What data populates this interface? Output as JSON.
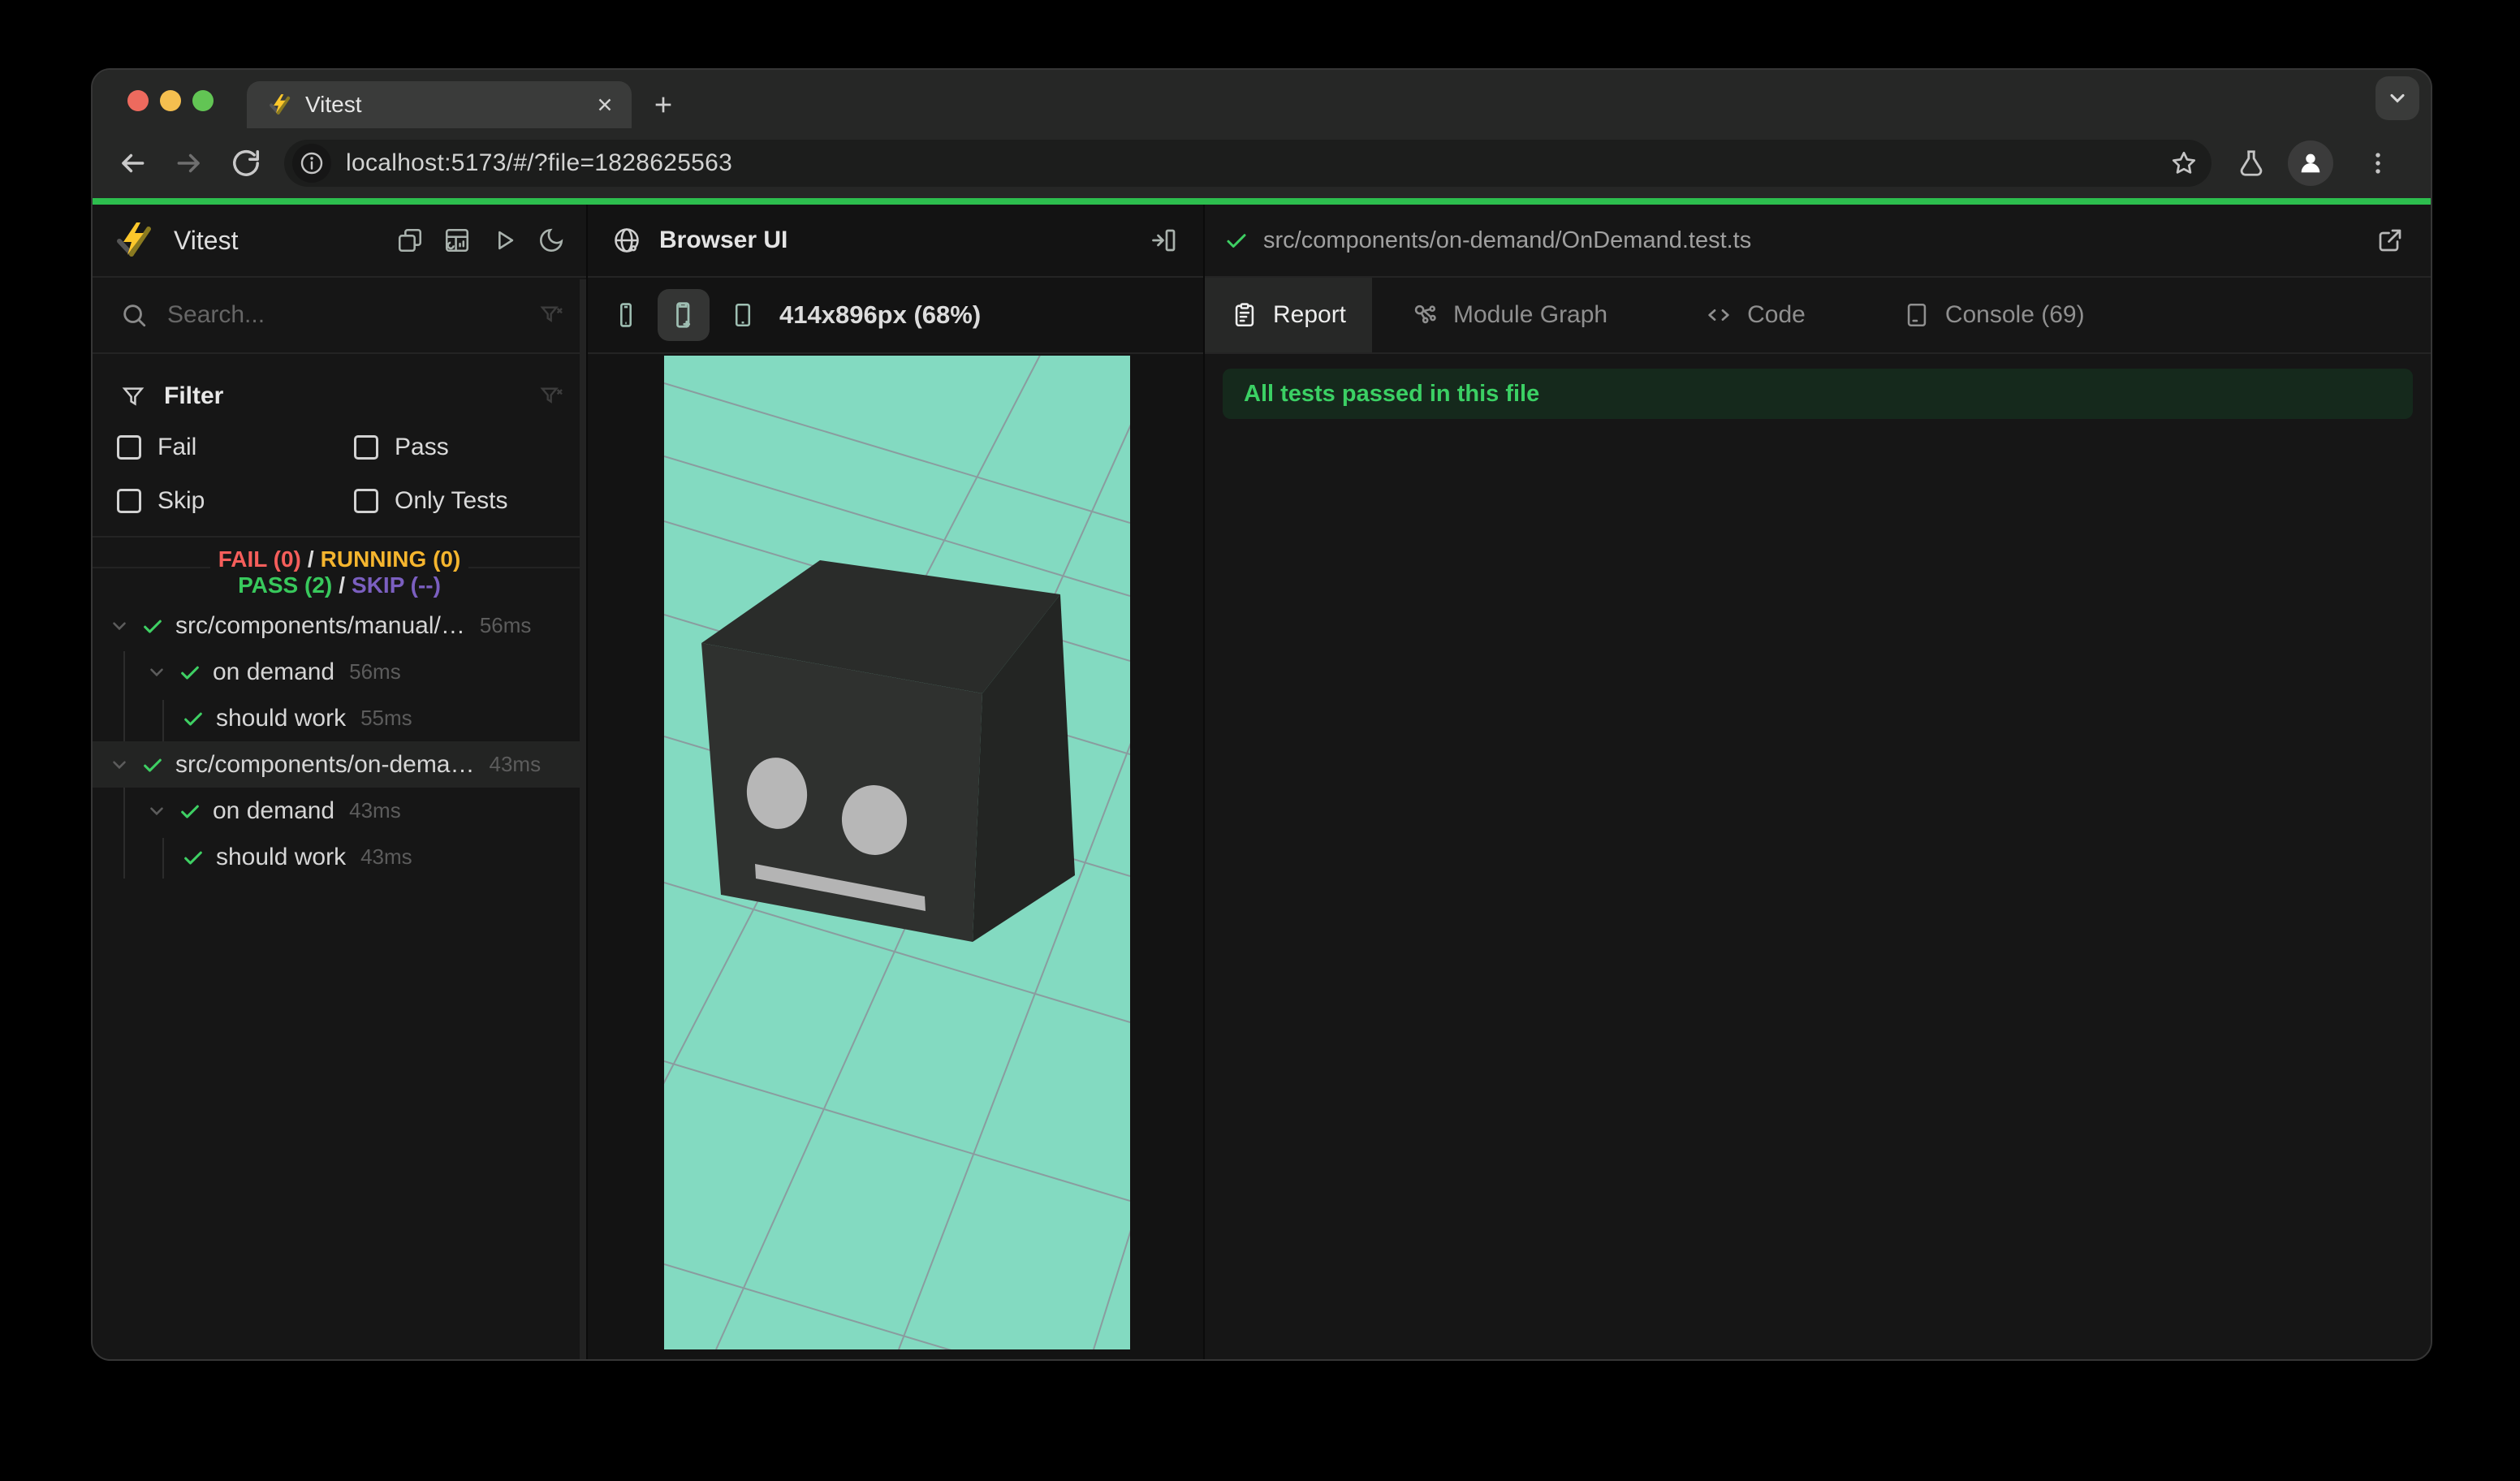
{
  "browser": {
    "tab_title": "Vitest",
    "url": "localhost:5173/#/?file=1828625563",
    "progress_color": "#2dbe4e"
  },
  "sidebar": {
    "app_title": "Vitest",
    "search_placeholder": "Search...",
    "filter": {
      "title": "Filter",
      "options": [
        {
          "label": "Fail",
          "checked": false
        },
        {
          "label": "Pass",
          "checked": false
        },
        {
          "label": "Skip",
          "checked": false
        },
        {
          "label": "Only Tests",
          "checked": false
        }
      ]
    },
    "status": {
      "fail": "FAIL (0)",
      "running": "RUNNING (0)",
      "pass": "PASS (2)",
      "skip": "SKIP (--)",
      "sep": "/",
      "colors": {
        "fail": "#f65e5b",
        "running": "#f5b52e",
        "pass": "#38c95c",
        "skip": "#7b5fc0"
      }
    },
    "tree": [
      {
        "label": "src/components/manual/…",
        "time": "56ms",
        "level": 0,
        "selected": false
      },
      {
        "label": "on demand",
        "time": "56ms",
        "level": 1,
        "selected": false
      },
      {
        "label": "should work",
        "time": "55ms",
        "level": 2,
        "selected": false
      },
      {
        "label": "src/components/on-dema…",
        "time": "43ms",
        "level": 0,
        "selected": true
      },
      {
        "label": "on demand",
        "time": "43ms",
        "level": 1,
        "selected": false
      },
      {
        "label": "should work",
        "time": "43ms",
        "level": 2,
        "selected": false
      }
    ]
  },
  "preview": {
    "panel_title": "Browser UI",
    "viewport_label": "414x896px (68%)",
    "scene_bg": "#83dac1",
    "cube_colors": {
      "top": "#2a2c2a",
      "front": "#2f312f",
      "side": "#232523",
      "face_parts": "#b7b7b7"
    }
  },
  "report": {
    "file_path": "src/components/on-demand/OnDemand.test.ts",
    "tabs": [
      {
        "label": "Report",
        "active": true
      },
      {
        "label": "Module Graph",
        "active": false
      },
      {
        "label": "Code",
        "active": false
      },
      {
        "label": "Console (69)",
        "active": false
      }
    ],
    "banner": "All tests passed in this file"
  }
}
